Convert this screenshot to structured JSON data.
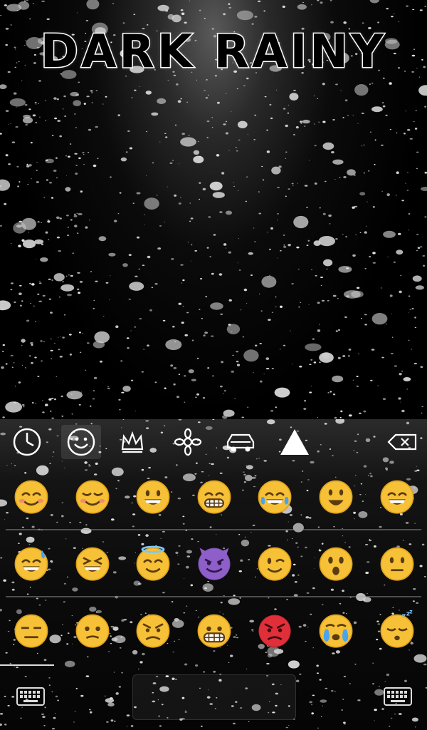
{
  "title": "DARK RAINY",
  "categories": [
    {
      "icon": "clock-icon",
      "active": false
    },
    {
      "icon": "smiley-icon",
      "active": true
    },
    {
      "icon": "crown-icon",
      "active": false
    },
    {
      "icon": "flower-icon",
      "active": false
    },
    {
      "icon": "car-icon",
      "active": false
    },
    {
      "icon": "triangle-icon",
      "active": false
    },
    {
      "icon": "backspace-icon",
      "active": false
    }
  ],
  "emoji_rows": [
    [
      "blush-smile",
      "relaxed-blush",
      "big-smile",
      "grin-teeth",
      "laugh-tears",
      "smiley-open",
      "smile-eyes"
    ],
    [
      "sweat-smile",
      "laughing-squint",
      "halo-smile",
      "smiling-devil",
      "wink",
      "surprised",
      "neutral-open"
    ],
    [
      "expressionless",
      "confused",
      "angry",
      "grimace",
      "pouting-red",
      "crying",
      "sleeping"
    ]
  ],
  "colors": {
    "face": "#f6c137",
    "face_edge": "#e0a21a",
    "red_face": "#e12f3a",
    "devil": "#8e5ec9",
    "tear": "#4aa3f0"
  }
}
